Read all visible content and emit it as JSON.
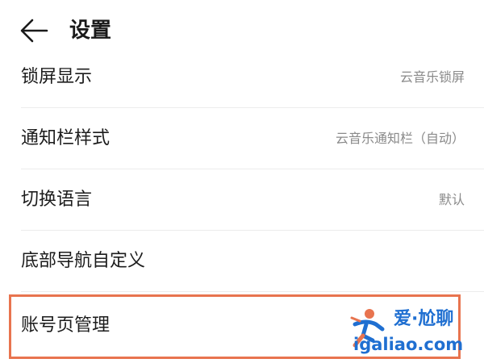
{
  "header": {
    "back_icon": "arrow-left-icon",
    "title": "设置"
  },
  "settings": [
    {
      "label": "锁屏显示",
      "value": "云音乐锁屏"
    },
    {
      "label": "通知栏样式",
      "value": "云音乐通知栏（自动）"
    },
    {
      "label": "切换语言",
      "value": "默认"
    },
    {
      "label": "底部导航自定义",
      "value": ""
    },
    {
      "label": "账号页管理",
      "value": ""
    }
  ],
  "highlight": {
    "color": "#e8744f"
  },
  "watermark": {
    "text": "爱·尬聊",
    "url": "igaliao.com",
    "color": "#1f6fd1",
    "accent": "#e8744f"
  }
}
